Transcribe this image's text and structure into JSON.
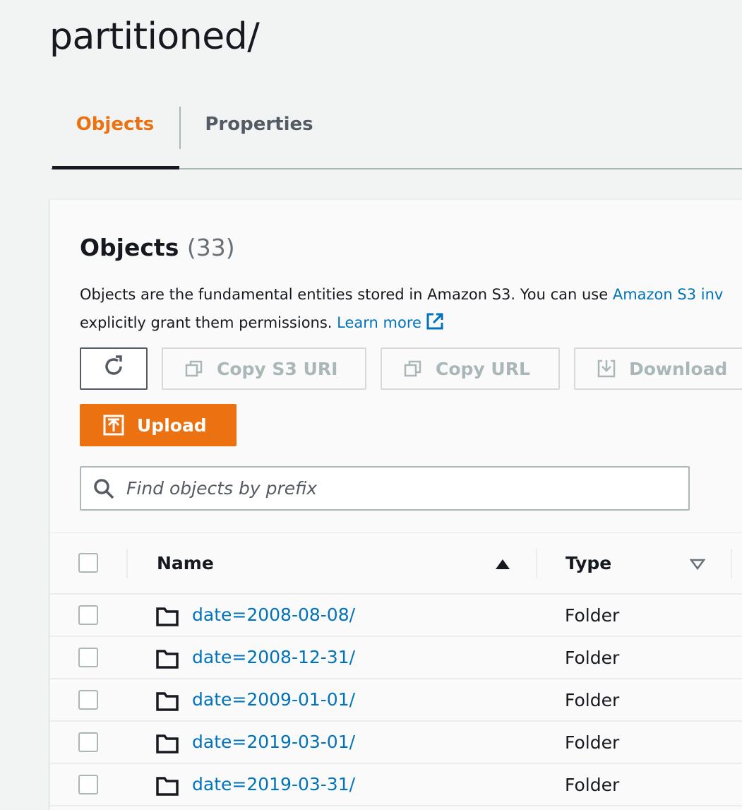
{
  "page": {
    "title": "partitioned/"
  },
  "tabs": [
    {
      "label": "Objects",
      "active": true
    },
    {
      "label": "Properties",
      "active": false
    }
  ],
  "objects": {
    "heading": "Objects",
    "count": "(33)",
    "description_line1_prefix": "Objects are the fundamental entities stored in Amazon S3. You can use ",
    "description_line1_link": "Amazon S3 inv",
    "description_line2_prefix": "explicitly grant them permissions. ",
    "learn_more": "Learn more"
  },
  "toolbar": {
    "refresh_icon": "refresh-icon",
    "copy_s3_uri": "Copy S3 URI",
    "copy_url": "Copy URL",
    "download": "Download",
    "upload": "Upload"
  },
  "search": {
    "placeholder": "Find objects by prefix",
    "value": ""
  },
  "table": {
    "columns": [
      "Name",
      "Type"
    ],
    "rows": [
      {
        "name": "date=2008-08-08/",
        "type": "Folder"
      },
      {
        "name": "date=2008-12-31/",
        "type": "Folder"
      },
      {
        "name": "date=2009-01-01/",
        "type": "Folder"
      },
      {
        "name": "date=2019-03-01/",
        "type": "Folder"
      },
      {
        "name": "date=2019-03-31/",
        "type": "Folder"
      }
    ]
  },
  "colors": {
    "accent": "#ec7211",
    "link": "#0073bb",
    "text": "#16191f",
    "disabled": "#aab7b8"
  }
}
